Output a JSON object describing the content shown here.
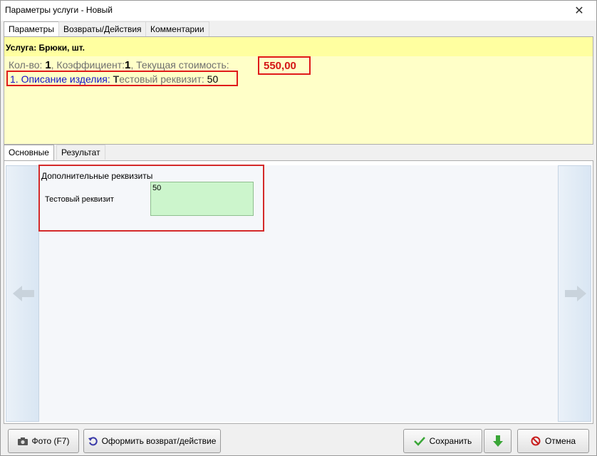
{
  "window": {
    "title": "Параметры услуги - Новый",
    "close_glyph": "✕"
  },
  "top_tabs": [
    {
      "label": "Параметры",
      "active": true
    },
    {
      "label": "Возвраты/Действия",
      "active": false
    },
    {
      "label": "Комментарии",
      "active": false
    }
  ],
  "service": {
    "title": "Услуга: Брюки, шт.",
    "qty_label": "Кол-во: ",
    "qty_value": "1",
    "coef_label": ", Коэффициент:",
    "coef_value": "1",
    "cost_label": ", Текущая стоимость:",
    "cost_value": "550,00",
    "desc_label": "1. Описание изделия: ",
    "desc_attr_first": "Т",
    "desc_attr_rest": "естовый реквизит: ",
    "desc_value": "50"
  },
  "mid_tabs": [
    {
      "label": "Основные",
      "active": true
    },
    {
      "label": "Результат",
      "active": false
    }
  ],
  "extra": {
    "title": "Дополнительные реквизиты",
    "field_label": "Тестовый реквизит",
    "field_value": "50"
  },
  "buttons": {
    "photo": "Фото (F7)",
    "return": "Оформить возврат/действие",
    "save": "Сохранить",
    "cancel": "Отмена"
  },
  "colors": {
    "highlight_border": "#e01a1a",
    "price": "#d41717",
    "desc_link": "#1414c8",
    "panel_bg": "#ffffc8",
    "field_bg": "#ccf5cc"
  }
}
